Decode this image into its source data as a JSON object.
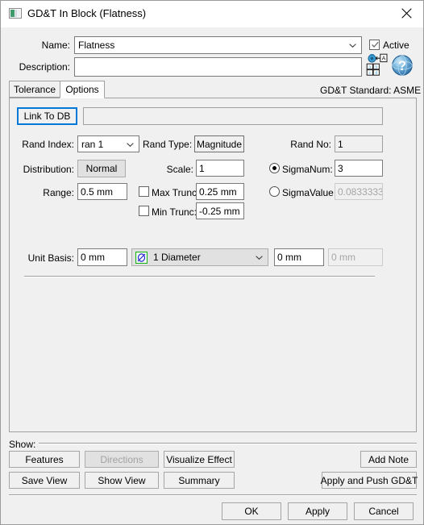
{
  "window": {
    "title": "GD&T In Block (Flatness)",
    "app_icon": "window-app-icon",
    "close_label": "✕"
  },
  "form": {
    "name_label": "Name:",
    "name_value": "Flatness",
    "active_label": "Active",
    "active_checked": true,
    "description_label": "Description:",
    "description_value": "",
    "translate_icon": "translate-icon",
    "help_icon": "help-globe-icon"
  },
  "tabs": {
    "items": [
      {
        "label": "Tolerance",
        "active": false
      },
      {
        "label": "Options",
        "active": true
      }
    ],
    "standard_text": "GD&T Standard: ASME"
  },
  "options": {
    "link_to_db_label": "Link To DB",
    "link_to_db_value": "",
    "rand_index_label": "Rand Index:",
    "rand_index_value": "ran 1",
    "rand_type_label": "Rand Type:",
    "rand_type_value": "Magnitude",
    "rand_no_label": "Rand No:",
    "rand_no_value": "1",
    "distribution_label": "Distribution:",
    "distribution_value": "Normal",
    "scale_label": "Scale:",
    "scale_value": "1",
    "sigma_num_label": "SigmaNum:",
    "sigma_num_value": "3",
    "sigma_num_selected": true,
    "range_label": "Range:",
    "range_value": "0.5 mm",
    "max_trunc_label": "Max Trunc:",
    "max_trunc_value": "0.25 mm",
    "max_trunc_checked": false,
    "sigma_value_label": "SigmaValue:",
    "sigma_value_value": "0.0833333",
    "sigma_value_selected": false,
    "min_trunc_label": "Min Trunc:",
    "min_trunc_value": "-0.25 mm",
    "min_trunc_checked": false,
    "unit_basis_label": "Unit Basis:",
    "unit_basis_value": "0 mm",
    "unit_basis_type_value": "1 Diameter",
    "unit_basis_type_icon": "diameter-symbol-icon",
    "unit_basis_second_value": "0 mm",
    "unit_basis_third_value": "0 mm"
  },
  "show": {
    "group_label": "Show:",
    "features_label": "Features",
    "directions_label": "Directions",
    "directions_disabled": true,
    "visualize_effect_label": "Visualize Effect",
    "add_note_label": "Add Note",
    "save_view_label": "Save View",
    "show_view_label": "Show View",
    "summary_label": "Summary",
    "apply_push_label": "Apply and Push GD&T"
  },
  "footer": {
    "ok_label": "OK",
    "apply_label": "Apply",
    "cancel_label": "Cancel"
  }
}
